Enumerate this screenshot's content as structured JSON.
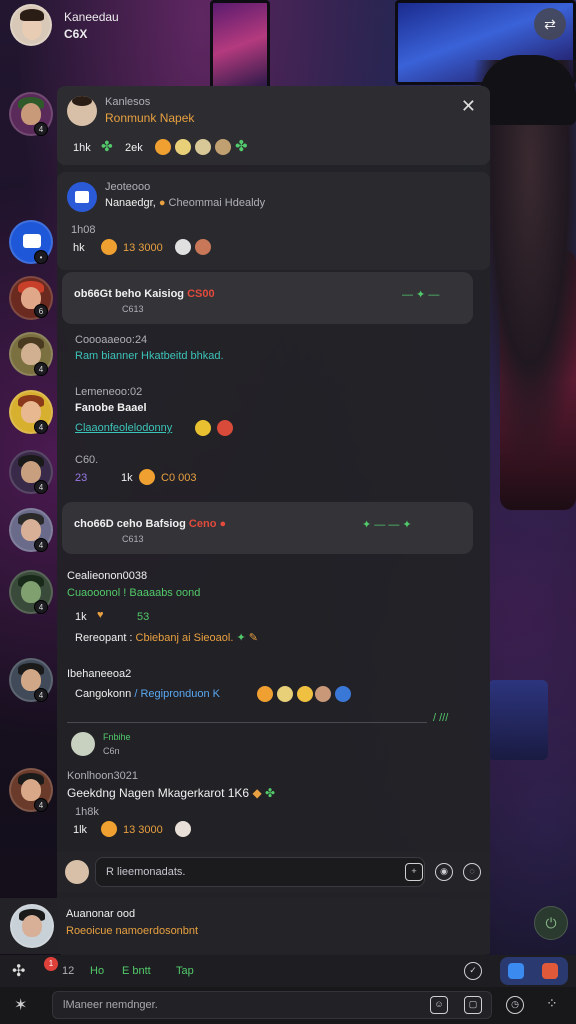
{
  "header": {
    "name": "Kaneedau",
    "sub": "C6X"
  },
  "pinned": {
    "author": "Kanlesos",
    "title": "Ronmunk Napek",
    "stat1": "1hk",
    "stat2": "2ek"
  },
  "message1": {
    "author": "Jeoteooo",
    "line": "Nanaedgr, ",
    "line_extra": "Cheommai Hdealdy",
    "meta_time": "1h08",
    "meta_stat": "hk",
    "meta_count": "13 3000"
  },
  "event1": {
    "title": "ob66Gt beho Kaisiog ",
    "title_red": "CS00",
    "sub": "C613"
  },
  "message2": {
    "author": "Coooaaeoo:24",
    "text": "Ram bianner Hkatbeitd bhkad."
  },
  "message3": {
    "author": "Lemeneoo:02",
    "title": "Fanobe Baael",
    "link": "Claaonfeolelodonny"
  },
  "reactions_row": {
    "label": "C60.",
    "count1": "23",
    "count2": "1k",
    "count3": "C0 003"
  },
  "event2": {
    "title": "cho66D ceho Bafsiog ",
    "title_red": "Ceno",
    "sub": "C613"
  },
  "message4": {
    "author": "Cealieonon0038",
    "line": "Cuaooonol ! Baaaabs oond",
    "stat1": "1k",
    "stat2": "53",
    "reply_label": "Rereopant : ",
    "reply_text": "Cbiebanj ai Sieoaol."
  },
  "message5": {
    "author": "Ibehaneeoa2",
    "line": "Cangokonn ",
    "link": "Regipronduon K"
  },
  "thread": {
    "name": "Fnbihe",
    "sub": "C6n",
    "time": "/ ///"
  },
  "message6": {
    "author": "Konlhoon3021",
    "line": "Geekdng Nagen Mkagerkarot 1K6",
    "meta_time": "1h8k",
    "meta_stat": "1lk",
    "meta_count": "13 3000"
  },
  "input": {
    "placeholder": "R lieemonadats."
  },
  "bottom_message": {
    "author": "Auanonar ood",
    "text": "Roeoicue namoerdosonbnt"
  },
  "bottom_tabs": {
    "tab1": "12",
    "tab2": "Ho",
    "tab3": "E bntt",
    "tab4": "Tap",
    "notif": "1"
  },
  "compose": {
    "placeholder": "lManeer nemdnger."
  },
  "colors": {
    "accent_orange": "#e8a040",
    "accent_green": "#52c96a",
    "accent_red": "#e24a3c",
    "accent_teal": "#3bc4b8",
    "accent_blue": "#5aa8f0"
  }
}
